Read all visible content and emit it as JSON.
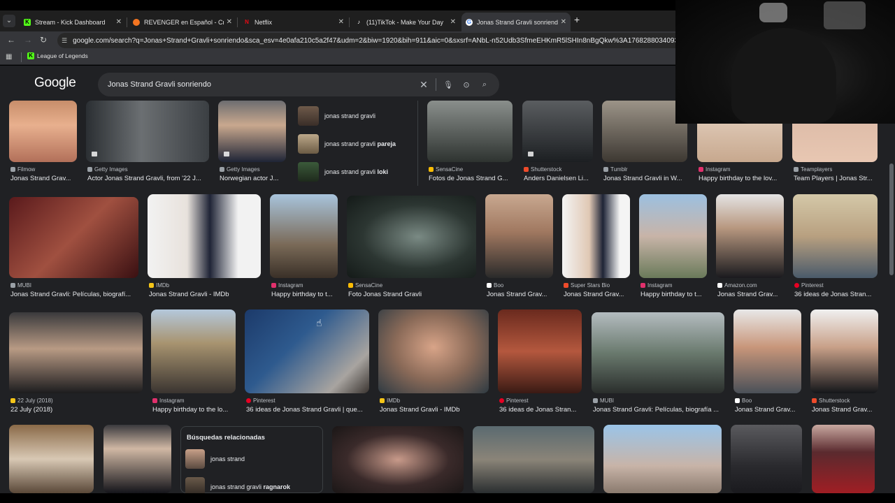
{
  "browser": {
    "tabs": [
      {
        "title": "Stream - Kick Dashboard",
        "favicon": "kick-icon",
        "color": "#53fc18"
      },
      {
        "title": "REVENGER en Español - Crunch",
        "favicon": "crunchyroll-icon",
        "color": "#f47521"
      },
      {
        "title": "Netflix",
        "favicon": "netflix-icon",
        "color": "#e50914"
      },
      {
        "title": "(11)TikTok - Make Your Day",
        "favicon": "tiktok-icon",
        "color": "#ffffff"
      },
      {
        "title": "Jonas Strand Gravli sonriendo -",
        "favicon": "google-icon",
        "color": "#4285f4"
      }
    ],
    "new_tab": "+",
    "url": "google.com/search?q=Jonas+Strand+Gravli+sonriendo&sca_esv=4e0afa210c5a2f47&udm=2&biw=1920&bih=911&aic=0&sxsrf=ANbL-n52Udb3SfmeEHKmR5lSHIn8nBgQkw%3A1768288034093&ei=lu9laeKz",
    "bookmarks": [
      {
        "label": "League of Legends"
      }
    ]
  },
  "google": {
    "logo": "Google",
    "query": "Jonas Strand Gravli sonriendo"
  },
  "suggestions": [
    {
      "prefix": "jonas strand gravli",
      "bold": ""
    },
    {
      "prefix": "jonas strand gravli ",
      "bold": "pareja"
    },
    {
      "prefix": "jonas strand gravli ",
      "bold": "loki"
    }
  ],
  "row1": [
    {
      "source": "Filmow",
      "title": "Jonas Strand Grav...",
      "src_color": "#9aa0a6"
    },
    {
      "source": "Getty Images",
      "title": "Actor Jonas Strand Gravli, from '22 J...",
      "src_color": "#9aa0a6"
    },
    {
      "source": "Getty Images",
      "title": "Norwegian actor J...",
      "src_color": "#9aa0a6"
    },
    {
      "source": "SensaCine",
      "title": "Fotos de Jonas Strand G...",
      "src_color": "#fbbc04"
    },
    {
      "source": "Shutterstock",
      "title": "Anders Danielsen Li...",
      "src_color": "#ee4b2b"
    },
    {
      "source": "Tumblr",
      "title": "Jonas Strand Gravli in W...",
      "src_color": "#9aa0a6"
    },
    {
      "source": "Instagram",
      "title": "Happy birthday to the lov...",
      "src_color": "#e1306c"
    },
    {
      "source": "Teamplayers",
      "title": "Team Players | Jonas Str...",
      "src_color": "#9aa0a6"
    }
  ],
  "row2": [
    {
      "source": "MUBI",
      "title": "Jonas Strand Gravli: Películas, biografí...",
      "src_color": "#9aa0a6"
    },
    {
      "source": "IMDb",
      "title": "Jonas Strand Gravli - IMDb",
      "src_color": "#f5c518"
    },
    {
      "source": "Instagram",
      "title": "Happy birthday to t...",
      "src_color": "#e1306c"
    },
    {
      "source": "SensaCine",
      "title": "Foto Jonas Strand Gravli",
      "src_color": "#fbbc04"
    },
    {
      "source": "Boo",
      "title": "Jonas Strand Grav...",
      "src_color": "#ffffff"
    },
    {
      "source": "Super Stars Bio",
      "title": "Jonas Strand Grav...",
      "src_color": "#ee4b2b"
    },
    {
      "source": "Instagram",
      "title": "Happy birthday to t...",
      "src_color": "#e1306c"
    },
    {
      "source": "Amazon.com",
      "title": "Jonas Strand Grav...",
      "src_color": "#ffffff"
    },
    {
      "source": "Pinterest",
      "title": "36 ideas de Jonas Stran...",
      "src_color": "#e60023"
    }
  ],
  "row3": [
    {
      "source": "22 July (2018)",
      "title": "22 July (2018)",
      "src_color": "#f5c518"
    },
    {
      "source": "Instagram",
      "title": "Happy birthday to the lo...",
      "src_color": "#e1306c"
    },
    {
      "source": "Pinterest",
      "title": "36 ideas de Jonas Strand Gravli | que...",
      "src_color": "#e60023"
    },
    {
      "source": "IMDb",
      "title": "Jonas Strand Gravli - IMDb",
      "src_color": "#f5c518"
    },
    {
      "source": "Pinterest",
      "title": "36 ideas de Jonas Stran...",
      "src_color": "#e60023"
    },
    {
      "source": "MUBI",
      "title": "Jonas Strand Gravli: Películas, biografía ...",
      "src_color": "#9aa0a6"
    },
    {
      "source": "Boo",
      "title": "Jonas Strand Grav...",
      "src_color": "#ffffff"
    },
    {
      "source": "Shutterstock",
      "title": "Jonas Strand Grav...",
      "src_color": "#ee4b2b"
    }
  ],
  "related": {
    "heading": "Búsquedas relacionadas",
    "items": [
      {
        "prefix": "jonas strand",
        "bold": ""
      },
      {
        "prefix": "jonas strand gravli ",
        "bold": "ragnarok"
      }
    ]
  }
}
